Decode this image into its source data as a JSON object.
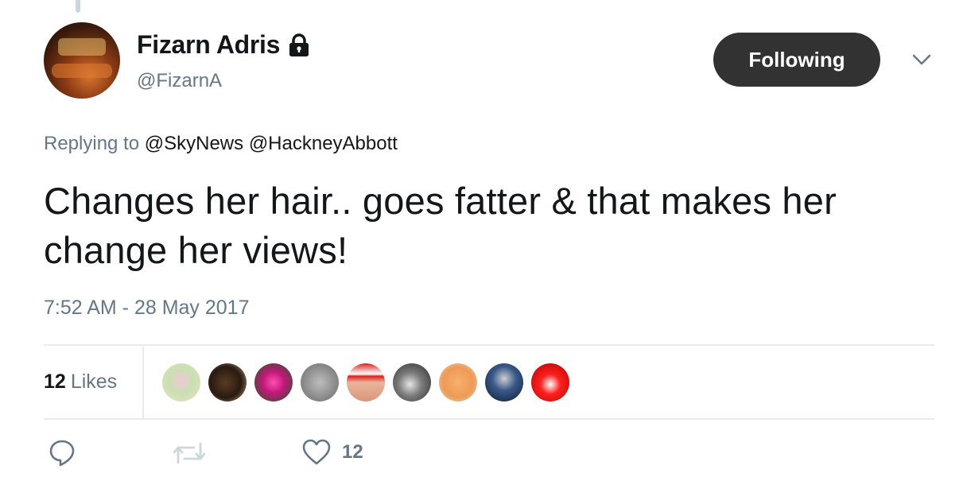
{
  "user": {
    "display_name": "Fizarn Adris",
    "handle": "@FizarnA",
    "protected_icon": "lock-icon"
  },
  "follow_button": {
    "label": "Following",
    "color": "#323232"
  },
  "menu_icon": "chevron-down-icon",
  "reply_context": {
    "prefix": "Replying to",
    "mentions": [
      "@SkyNews",
      "@HackneyAbbott"
    ]
  },
  "tweet": {
    "text": "Changes her hair.. goes fatter & that makes her change her views!",
    "timestamp": "7:52 AM - 28 May 2017"
  },
  "stats": {
    "likes_count": "12",
    "likes_label": "Likes",
    "liker_avatar_count": 9
  },
  "actions": {
    "reply_icon": "reply-icon",
    "retweet_icon": "retweet-icon",
    "like_icon": "heart-icon",
    "like_count": "12"
  },
  "colors": {
    "secondary_text": "#657786",
    "primary_text": "#14171a",
    "divider": "#e6ecf0"
  }
}
